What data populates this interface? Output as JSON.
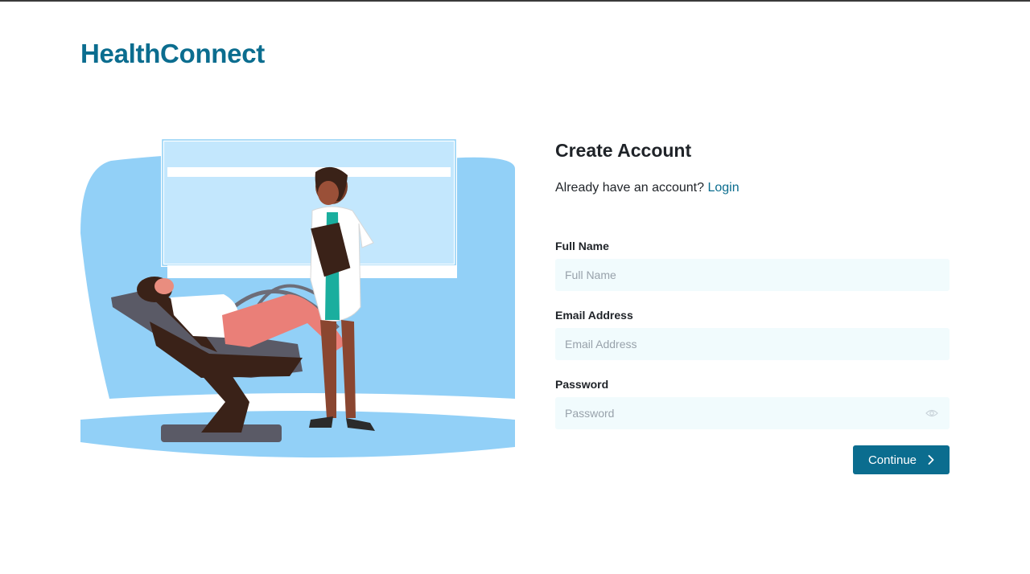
{
  "brand": {
    "name": "HealthConnect"
  },
  "illustration": {
    "icon": "doctor-patient-illustration"
  },
  "form": {
    "title": "Create Account",
    "login_prompt": "Already have an account?",
    "login_link": "Login",
    "fields": {
      "full_name": {
        "label": "Full Name",
        "placeholder": "Full Name",
        "value": ""
      },
      "email": {
        "label": "Email Address",
        "placeholder": "Email Address",
        "value": ""
      },
      "password": {
        "label": "Password",
        "placeholder": "Password",
        "value": "",
        "toggle_icon": "eye-icon"
      }
    },
    "submit": {
      "label": "Continue",
      "icon": "chevron-right-icon"
    }
  },
  "colors": {
    "brand": "#0b6d8f",
    "field_bg": "#f1fbfd",
    "illustration_blue": "#92d0f7"
  }
}
